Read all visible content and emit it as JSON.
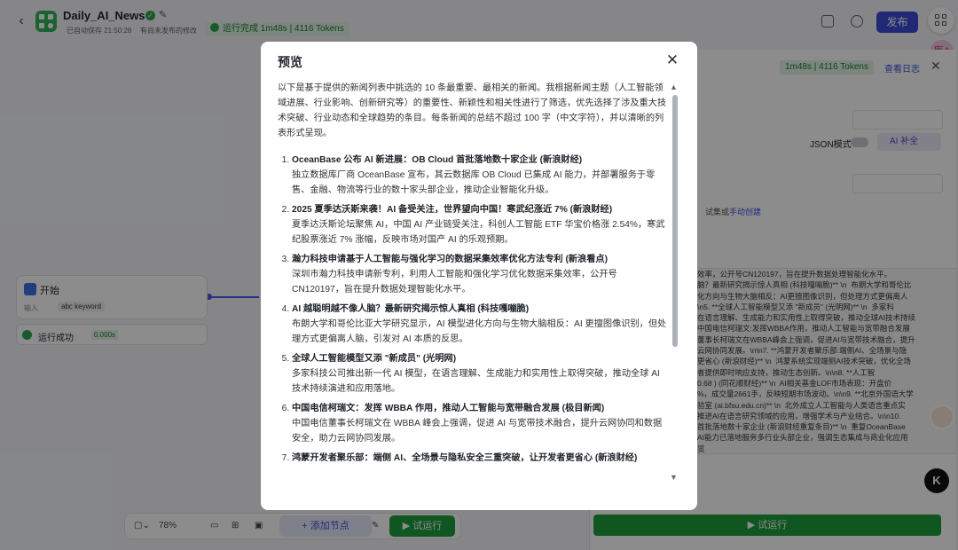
{
  "app": {
    "name": "Daily_AI_News",
    "autosave": "已自动保存 21:50:28",
    "unpublished": "有尚未发布的修改",
    "run_status": "运行完成 1m48s | 4116 Tokens",
    "publish_label": "发布",
    "avatar_text": "医A"
  },
  "canvas": {
    "start_node": {
      "title": "开始",
      "input_label": "输入",
      "keyword": "abc keyword"
    },
    "run_ok": {
      "label": "运行成功",
      "time": "0.000s"
    },
    "toolbar": {
      "zoom": "78%",
      "add_node": "+ 添加节点",
      "test_run": "▶ 试运行"
    }
  },
  "right_panel": {
    "status": "1m48s | 4116 Tokens",
    "log_link": "查看日志",
    "json_mode": "JSON模式",
    "ai_button": "AI 补全",
    "link_text": "试集或",
    "link_action": "手动创建",
    "output_text": "效率，公开号CN120197，旨在提升数据处理智能化水平。\n脑？最新研究揭示惊人真相 (科技嘎嘣脆)** \\n  布朗大学和哥伦比\n化方向与生物大脑相反：AI更擅图像识别，但处理方式更偏离人\n\\n5. **全球人工智能模型又添 \"新成员\" (光明网)** \\n  多家科\n在语言理解、生成能力和实用性上取得突破，推动全球AI技术持续\n中国电信柯瑞文:发挥WBBA作用，推动人工智能与宽带融合发展\n董事长柯瑞文在WBBA峰会上强调，促进AI与宽带技术融合，提升\n云网协同发展。\\n\\n7. **鸿蒙开发者聚乐部:端侧AI、全场景与隐\n更省心 (新浪财经)** \\n  鸿蒙系统实现端侧AI技术突破，优化全场\n者提供即时响应支持，推动生态创新。\\n\\n8. **人工智\n0.68 ) (同花顺财经)** \\n  AI相关基金LOF市场表现：开盘价\n%，成交量2661手，反映短期市场波动。\\n\\n9. **北京外国语大学\n验室 (ai.bfsu.edu.cn)** \\n  北外成立人工智能与人类语言重点实\n推进AI在语言研究领域的应用，增强学术与产业结合。\\n\\n10.\n首批落地数十家企业 (新浪财经重复条目)** \\n  重复OceanBase\nAI能力已落地服务多行业头部企业，强调生态集成与商业化应用\n览",
    "test_run": "▶ 试运行"
  },
  "modal": {
    "title": "预览",
    "intro": "以下是基于提供的新闻列表中挑选的 10 条最重要、最相关的新闻。我根据新闻主题（人工智能领域进展、行业影响、创新研究等）的重要性、新颖性和相关性进行了筛选，优先选择了涉及重大技术突破、行业动态和全球趋势的条目。每条新闻的总结不超过 100 字（中文字符），并以清晰的列表形式呈现。",
    "items": [
      {
        "title": "OceanBase 公布 AI 新进展：OB Cloud 首批落地数十家企业 (新浪财经)",
        "desc": "独立数据库厂商 OceanBase 宣布，其云数据库 OB Cloud 已集成 AI 能力，并部署服务于零售、金融、物流等行业的数十家头部企业，推动企业智能化升级。"
      },
      {
        "title": "2025 夏季达沃斯来袭！AI 备受关注，世界望向中国！寒武纪涨近 7% (新浪财经)",
        "desc": "夏季达沃斯论坛聚焦 AI，中国 AI 产业链受关注，科创人工智能 ETF 华宝价格涨 2.54%，寒武纪股票涨近 7% 涨幅，反映市场对国产 AI 的乐观预期。"
      },
      {
        "title": "瀚力科技申请基于人工智能与强化学习的数据采集效率优化方法专利 (新浪看点)",
        "desc": "深圳市瀚力科技申请新专利，利用人工智能和强化学习优化数据采集效率，公开号 CN120197，旨在提升数据处理智能化水平。"
      },
      {
        "title": "AI 越聪明越不像人脑？最新研究揭示惊人真相 (科技嘎嘣脆)",
        "desc": "布朗大学和哥伦比亚大学研究显示，AI 模型进化方向与生物大脑相反：AI 更擅图像识别，但处理方式更偏离人脑，引发对 AI 本质的反思。"
      },
      {
        "title": "全球人工智能模型又添 \"新成员\" (光明网)",
        "desc": "多家科技公司推出新一代 AI 模型，在语言理解、生成能力和实用性上取得突破，推动全球 AI 技术持续演进和应用落地。"
      },
      {
        "title": "中国电信柯瑞文：发挥 WBBA 作用，推动人工智能与宽带融合发展 (极目新闻)",
        "desc": "中国电信董事长柯瑞文在 WBBA 峰会上强调，促进 AI 与宽带技术融合，提升云网协同和数据安全，助力云网协同发展。"
      },
      {
        "title": "鸿蒙开发者聚乐部：端侧 AI、全场景与隐私安全三重突破，让开发者更省心 (新浪财经)",
        "desc": ""
      }
    ]
  }
}
